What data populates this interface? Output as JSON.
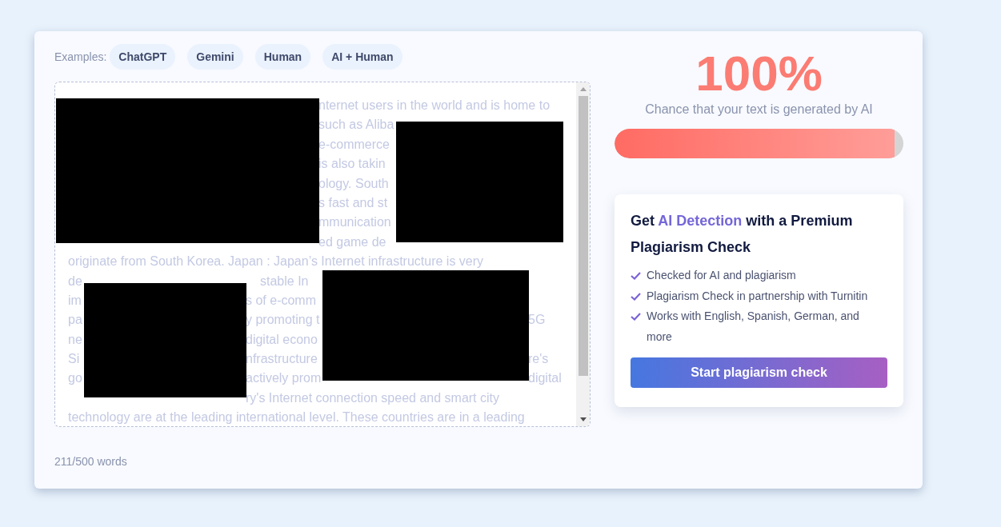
{
  "examples": {
    "label": "Examples:",
    "chips": [
      "ChatGPT",
      "Gemini",
      "Human",
      "AI + Human"
    ]
  },
  "text_lines": [
    [
      "nternet users in the world and is home to"
    ],
    [
      "such as Aliba"
    ],
    [
      "e-commerce"
    ],
    [
      "is also takin"
    ],
    [
      "ology. South"
    ],
    [
      "s fast and st"
    ],
    [
      "mmunication"
    ],
    [
      "ed game de"
    ],
    [
      "originate from South Korea. Japan : Japan’s Internet infrastructure is very"
    ],
    [
      "de",
      "stable In"
    ],
    [
      "im",
      "s of e-comm"
    ],
    [
      "pa",
      "y promoting t",
      "5G"
    ],
    [
      "ne",
      "digital econo"
    ],
    [
      "Si",
      "nfrastructure",
      "re's"
    ],
    [
      "go",
      "actively prom",
      "digital"
    ],
    [
      "ry's Internet connection speed and smart city"
    ],
    [
      "technology are at the leading international level. These countries are in a leading"
    ]
  ],
  "word_count": "211/500 words",
  "score": {
    "value": "100%",
    "caption": "Chance that your text is generated by AI",
    "level": 0.97
  },
  "promo": {
    "title": [
      {
        "text": "Get ",
        "highlight": false
      },
      {
        "text": "AI Detection",
        "highlight": true
      },
      {
        "text": " with a Premium Plagiarism Check",
        "highlight": false
      }
    ],
    "features": [
      "Checked for AI and plagiarism",
      "Plagiarism Check in partnership with Turnitin",
      "Works with English, Spanish, German, and more"
    ],
    "button": "Start plagiarism check"
  }
}
